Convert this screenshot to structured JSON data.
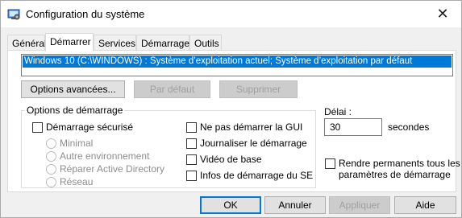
{
  "window": {
    "title": "Configuration du système",
    "close_glyph": "✕"
  },
  "tabs": [
    {
      "label": "Général"
    },
    {
      "label": "Démarrer"
    },
    {
      "label": "Services"
    },
    {
      "label": "Démarrage"
    },
    {
      "label": "Outils"
    }
  ],
  "boot_list": {
    "items": [
      "Windows 10 (C:\\WINDOWS) : Système d’exploitation actuel; Système d’exploitation par défaut"
    ]
  },
  "buttons": {
    "advanced": "Options avancées...",
    "set_default": "Par défaut",
    "delete": "Supprimer"
  },
  "boot_options": {
    "group_label": "Options de démarrage",
    "safe_boot": "Démarrage sécurisé",
    "safe_modes": [
      "Minimal",
      "Autre environnement",
      "Réparer Active Directory",
      "Réseau"
    ],
    "no_gui": "Ne pas démarrer la GUI",
    "boot_log": "Journaliser le démarrage",
    "base_video": "Vidéo de base",
    "os_boot_info": "Infos de démarrage du SE"
  },
  "timeout": {
    "label": "Délai :",
    "value": "30",
    "unit": "secondes"
  },
  "permanent": {
    "label_line1": "Rendre permanents tous les",
    "label_line2": "paramètres de démarrage"
  },
  "footer": {
    "ok": "OK",
    "cancel": "Annuler",
    "apply": "Appliquer",
    "help": "Aide"
  }
}
